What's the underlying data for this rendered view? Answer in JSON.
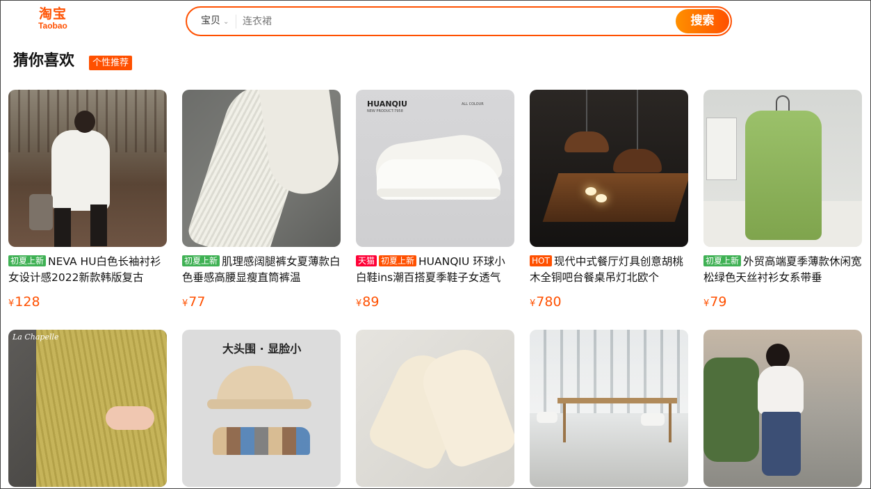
{
  "header": {
    "logo_cn": "淘宝",
    "logo_en": "Taobao",
    "search_scope": "宝贝",
    "search_placeholder": "连衣裙",
    "search_button": "搜索"
  },
  "section": {
    "title": "猜你喜欢",
    "badge": "个性推荐"
  },
  "products": [
    {
      "tag": "初夏上新",
      "tag_type": "new",
      "title": "NEVA HU白色长袖衬衫女设计感2022新款韩版复古",
      "price": "128",
      "image": "woman-white-shirt-photo"
    },
    {
      "tag": "初夏上新",
      "tag_type": "new",
      "title": "肌理感阔腿裤女夏薄款白色垂感高腰显瘦直筒裤温",
      "price": "77",
      "image": "white-trousers-photo"
    },
    {
      "tag": "天猫",
      "tag2": "初夏上新",
      "tag_type": "tmall",
      "title": "HUANQIU 环球小白鞋ins潮百搭夏季鞋子女透气",
      "price": "89",
      "image": "white-sneakers-photo",
      "overlay_brand": "HUANQIU",
      "overlay_sub": "NEW PRODUCT:7958",
      "overlay_right": "ALL COLOUR"
    },
    {
      "tag": "HOT",
      "tag_type": "hot",
      "title": "现代中式餐厅灯具创意胡桃木全铜吧台餐桌吊灯北欧个",
      "price": "780",
      "image": "pendant-lamps-photo"
    },
    {
      "tag": "初夏上新",
      "tag_type": "new",
      "title": "外贸高端夏季薄款休闲宽松绿色天丝衬衫女系带垂",
      "price": "79",
      "image": "green-shirt-photo"
    },
    {
      "image": "yellow-knit-photo",
      "overlay_brand": "La Chapelle"
    },
    {
      "image": "baseball-cap-photo",
      "overlay_text": "大头围 · 显脸小"
    },
    {
      "image": "canvas-sneakers-photo"
    },
    {
      "image": "office-table-photo"
    },
    {
      "image": "woman-white-sweater-photo"
    }
  ],
  "colors": {
    "brand": "#ff5000",
    "tag_new": "#3fb154",
    "tag_tmall": "#ff0036",
    "price": "#ff5000"
  },
  "currency": "¥"
}
